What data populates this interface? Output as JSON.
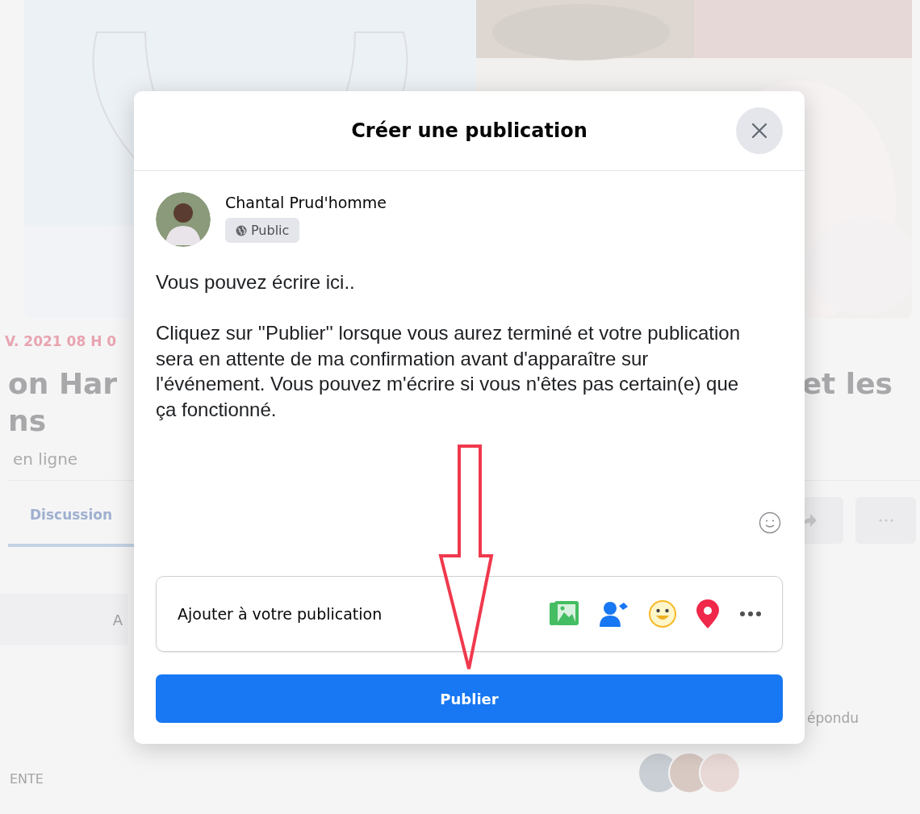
{
  "background_page": {
    "date": "V. 2021 08 H 0",
    "title_left": [
      "on Har",
      "ns"
    ],
    "title_right": "et les",
    "subtitle": "en ligne",
    "tabs": [
      {
        "label": "Discussion",
        "selected": true
      }
    ],
    "band_letter": "A",
    "section_label": "ENTE",
    "responses_label": "épondu"
  },
  "dialog": {
    "title": "Créer une publication",
    "author": {
      "name": "Chantal Prud'homme",
      "audience": "Public"
    },
    "text": [
      "Vous pouvez écrire ici..",
      "Cliquez sur ''Publier'' lorsque vous aurez terminé et votre publication sera en attente de ma confirmation avant d'apparaître sur l'événement. Vous pouvez m'écrire si vous n'êtes pas certain(e) que ça fonctionné."
    ],
    "add_to_post": {
      "label": "Ajouter à votre publication"
    },
    "submit": "Publier"
  }
}
